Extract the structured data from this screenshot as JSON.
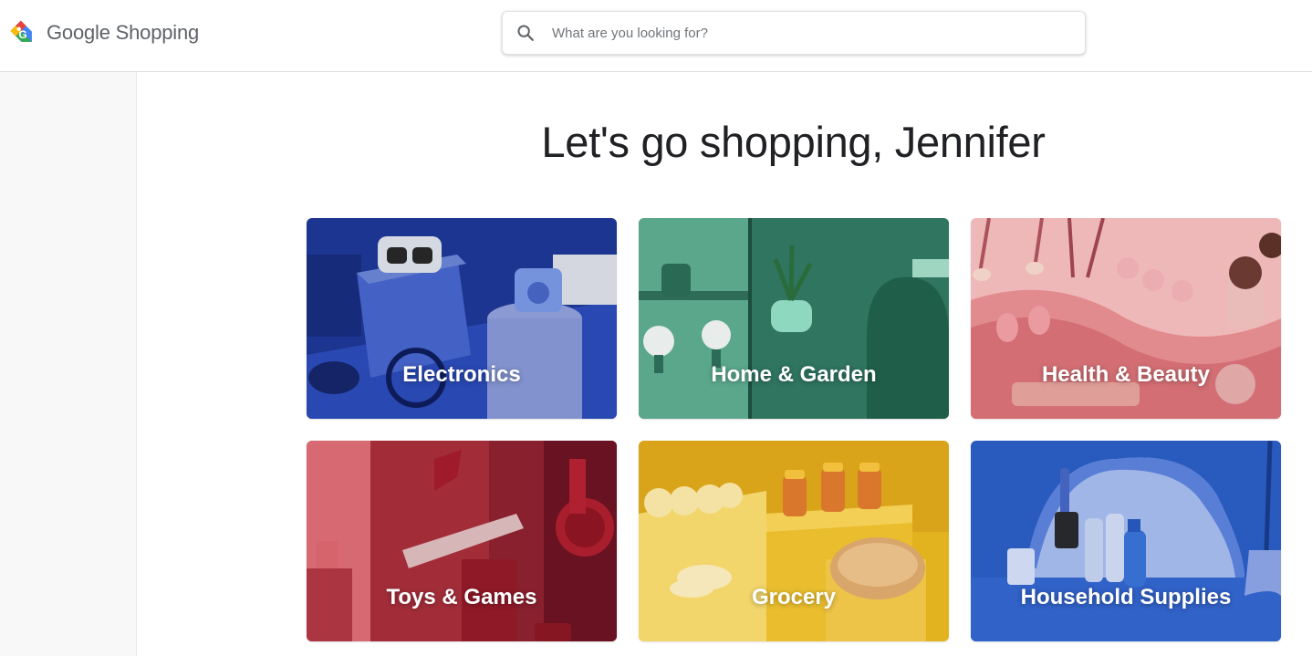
{
  "header": {
    "logo": {
      "text_google": "Google",
      "text_product": "Shopping",
      "icon": "google-shopping-tag-icon"
    },
    "search": {
      "placeholder": "What are you looking for?",
      "value": "",
      "icon": "search-icon"
    }
  },
  "main": {
    "greeting": "Let's go shopping, Jennifer",
    "categories": [
      {
        "label": "Electronics",
        "theme": "#2b4ab8"
      },
      {
        "label": "Home & Garden",
        "theme": "#3e8f78"
      },
      {
        "label": "Health & Beauty",
        "theme": "#e48a8e"
      },
      {
        "label": "Toys & Games",
        "theme": "#b8323f"
      },
      {
        "label": "Grocery",
        "theme": "#e0b52a"
      },
      {
        "label": "Household Supplies",
        "theme": "#2f63c8"
      }
    ]
  },
  "colors": {
    "accent_blue": "#4285f4",
    "accent_red": "#ea4335",
    "accent_yellow": "#fbbc05",
    "accent_green": "#34a853",
    "text_primary": "#202124",
    "text_secondary": "#5f6368"
  }
}
